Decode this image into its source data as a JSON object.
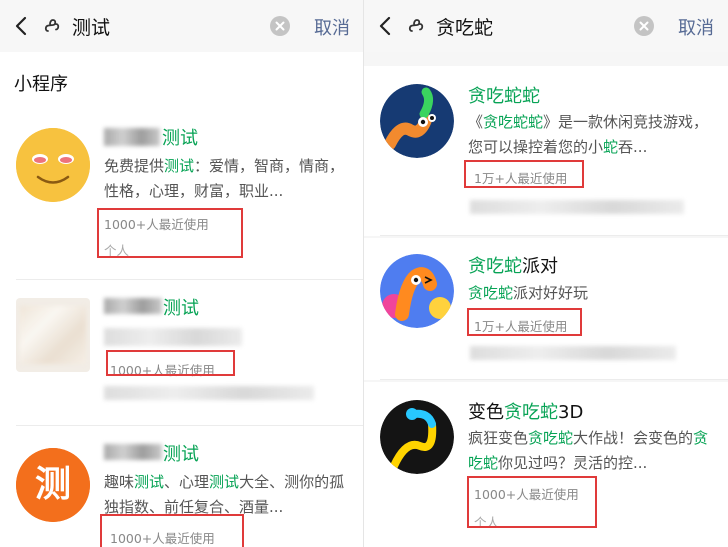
{
  "left": {
    "back_icon": "chevron-left-icon",
    "search_icon": "mini-program-icon",
    "query": "测试",
    "cancel": "取消",
    "section_title": "小程序",
    "items": [
      {
        "name_highlight": "测试",
        "desc_pre": "免费提供",
        "desc_hl": "测试",
        "desc_post": "：爱情，智商，情商，性格，心理，财富，职业...",
        "usage": "1000+人最近使用",
        "owner": "个人"
      },
      {
        "name_highlight": "测试",
        "usage": "1000+人最近使用"
      },
      {
        "name_highlight": "测试",
        "desc_pre": "趣味",
        "desc_hl": "测试",
        "desc_mid": "、心理",
        "desc_hl2": "测试",
        "desc_post": "大全、测你的孤独指数、前任复合、酒量...",
        "usage": "1000+人最近使用",
        "avatar_text": "测"
      }
    ]
  },
  "right": {
    "back_icon": "chevron-left-icon",
    "search_icon": "mini-program-icon",
    "query": "贪吃蛇",
    "cancel": "取消",
    "items": [
      {
        "name_hl": "贪吃蛇蛇",
        "name_post": "",
        "desc_p1": "《",
        "desc_h1": "贪吃蛇蛇",
        "desc_p2": "》是一款休闲竞技游戏，您可以操控着您的小",
        "desc_h2": "蛇",
        "desc_p3": "吞...",
        "usage": "1万+人最近使用"
      },
      {
        "name_hl": "贪吃蛇",
        "name_post": "派对",
        "desc_h1": "贪吃蛇",
        "desc_p2": "派对好好玩",
        "usage": "1万+人最近使用"
      },
      {
        "name_pre": "变色",
        "name_hl": "贪吃蛇",
        "name_post": "3D",
        "desc_p1": "疯狂变色",
        "desc_h1": "贪吃蛇",
        "desc_p2": "大作战！会变色的",
        "desc_h2": "贪吃蛇",
        "desc_p3": "你见过吗？灵活的控...",
        "usage": "1000+人最近使用",
        "owner": "个人"
      }
    ]
  },
  "colors": {
    "highlight": "#07a355",
    "link": "#576b95",
    "annotation_box": "#e03a3a"
  }
}
